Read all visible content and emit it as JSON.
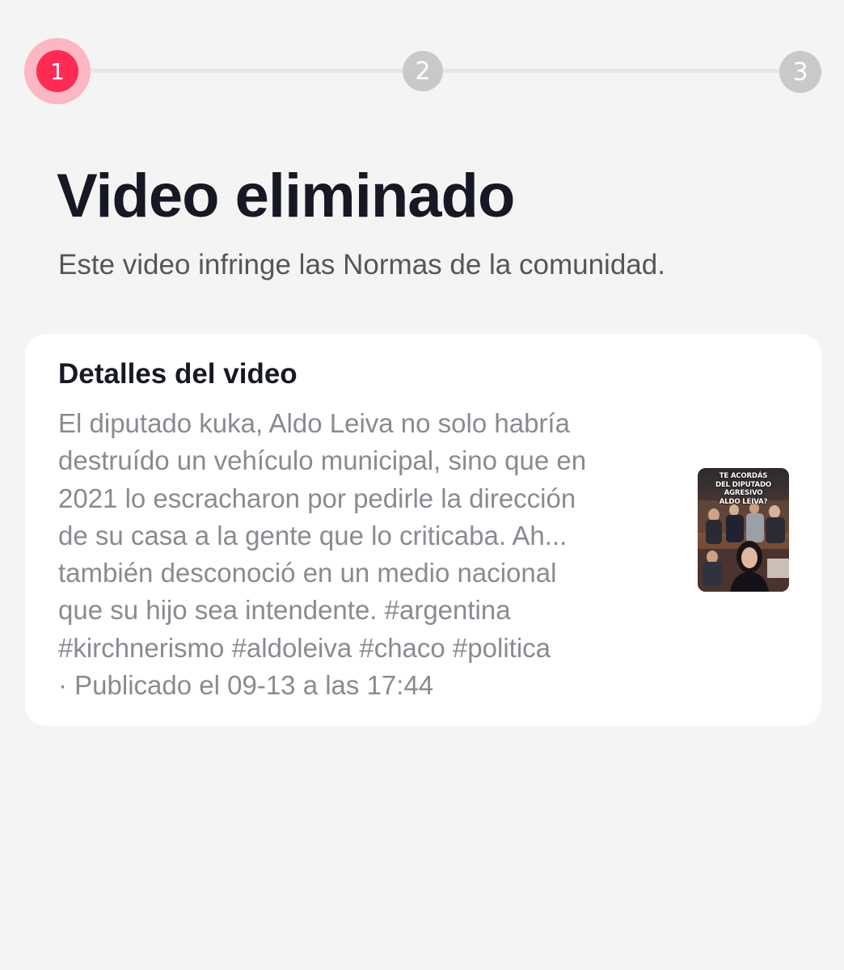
{
  "stepper": {
    "steps": [
      "1",
      "2",
      "3"
    ],
    "current": 1,
    "active_color": "#fe2c55",
    "inactive_color": "#c9c9c9"
  },
  "header": {
    "title": "Video eliminado",
    "subtitle": "Este video infringe las Normas de la comunidad."
  },
  "video_details": {
    "heading": "Detalles del video",
    "description_lines": [
      "El diputado kuka, Aldo Leiva no solo habría",
      "destruído un vehículo municipal, sino que en",
      "2021 lo escracharon por pedirle la dirección",
      "de su casa a la gente que lo criticaba. Ah...",
      "también desconoció en un medio nacional",
      "que su hijo sea intendente. #argentina",
      "#kirchnerismo #aldoleiva #chaco #politica",
      "· Publicado el 09-13 a las 17:44"
    ],
    "thumbnail": {
      "caption_lines": [
        "TE ACORDÁS",
        "DEL DIPUTADO AGRESIVO",
        "ALDO LEIVA?"
      ]
    }
  }
}
